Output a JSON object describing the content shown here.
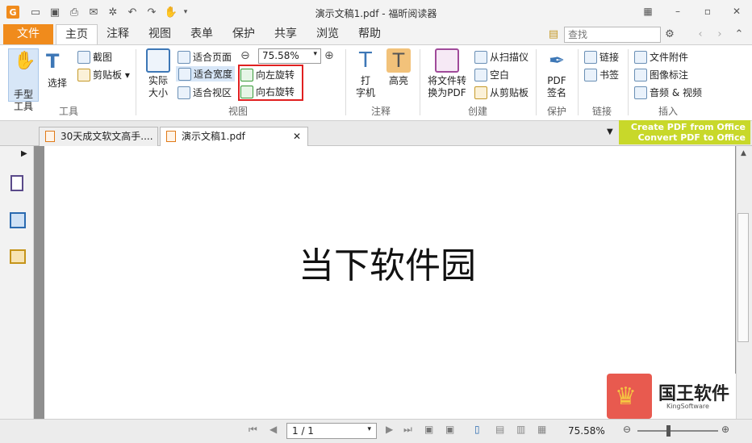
{
  "window": {
    "title": "演示文稿1.pdf - 福昕阅读器"
  },
  "menu_tabs": [
    "文件",
    "主页",
    "注释",
    "视图",
    "表单",
    "保护",
    "共享",
    "浏览",
    "帮助"
  ],
  "search": {
    "placeholder": "查找"
  },
  "ribbon": {
    "tools": {
      "hand": "手型\n工具",
      "select": "选择",
      "snapshot": "截图",
      "clipboard": "剪贴板",
      "group": "工具"
    },
    "view": {
      "actual_size": "实际\n大小",
      "fit_page": "适合页面",
      "fit_width": "适合宽度",
      "fit_visible": "适合视区",
      "zoom": "75.58%",
      "rotate_left": "向左旋转",
      "rotate_right": "向右旋转",
      "group": "视图"
    },
    "comment": {
      "typewriter": "打\n字机",
      "highlight": "高亮",
      "group": "注释"
    },
    "create": {
      "convert": "将文件转\n换为PDF",
      "from_scanner": "从扫描仪",
      "blank": "空白",
      "from_clipboard": "从剪贴板",
      "group": "创建"
    },
    "protect": {
      "sign": "PDF\n签名",
      "group": "保护"
    },
    "links": {
      "link": "链接",
      "bookmark": "书签",
      "group": "链接"
    },
    "insert": {
      "file_attachment": "文件附件",
      "image_annotation": "图像标注",
      "audio_video": "音频 & 视频",
      "group": "插入"
    }
  },
  "promo": {
    "line1": "Create PDF from Office",
    "line2": "Convert PDF to Office"
  },
  "doc_tabs": [
    {
      "label": "30天成文软文高手...."
    },
    {
      "label": "演示文稿1.pdf"
    }
  ],
  "document": {
    "text": "当下软件园"
  },
  "status": {
    "page": "1 / 1",
    "zoom": "75.58%"
  },
  "watermark": {
    "name": "国王软件",
    "sub": "KingSoftware"
  },
  "colors": {
    "file_tab": "#f08b1c",
    "promo": "#c8d82a",
    "rotate_highlight": "#e02020"
  }
}
